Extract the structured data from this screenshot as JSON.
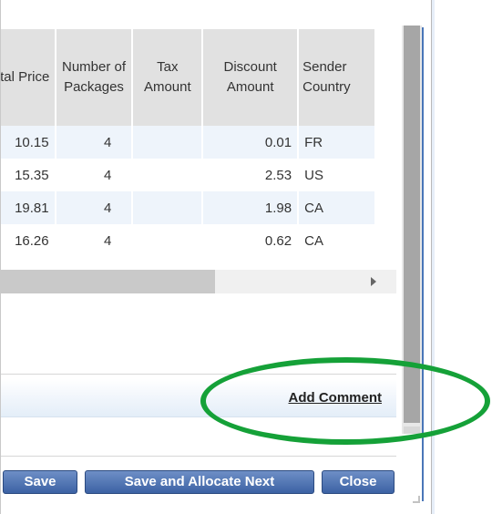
{
  "grid": {
    "columns": [
      "Total Price",
      "Number of Packages",
      "Tax Amount",
      "Discount Amount",
      "Sender Country"
    ],
    "rows": [
      {
        "total_price": "10.15",
        "packages": "4",
        "tax": "",
        "discount": "0.01",
        "country": "FR"
      },
      {
        "total_price": "15.35",
        "packages": "4",
        "tax": "",
        "discount": "2.53",
        "country": "US"
      },
      {
        "total_price": "19.81",
        "packages": "4",
        "tax": "",
        "discount": "1.98",
        "country": "CA"
      },
      {
        "total_price": "16.26",
        "packages": "4",
        "tax": "",
        "discount": "0.62",
        "country": "CA"
      }
    ]
  },
  "comment_bar": {
    "add_comment_label": "Add Comment"
  },
  "buttons": {
    "save": "Save",
    "save_allocate_next": "Save and Allocate Next",
    "close": "Close"
  },
  "colors": {
    "button_blue": "#3c62a4",
    "highlight_green": "#15a138",
    "row_alt": "#eef4fb"
  }
}
